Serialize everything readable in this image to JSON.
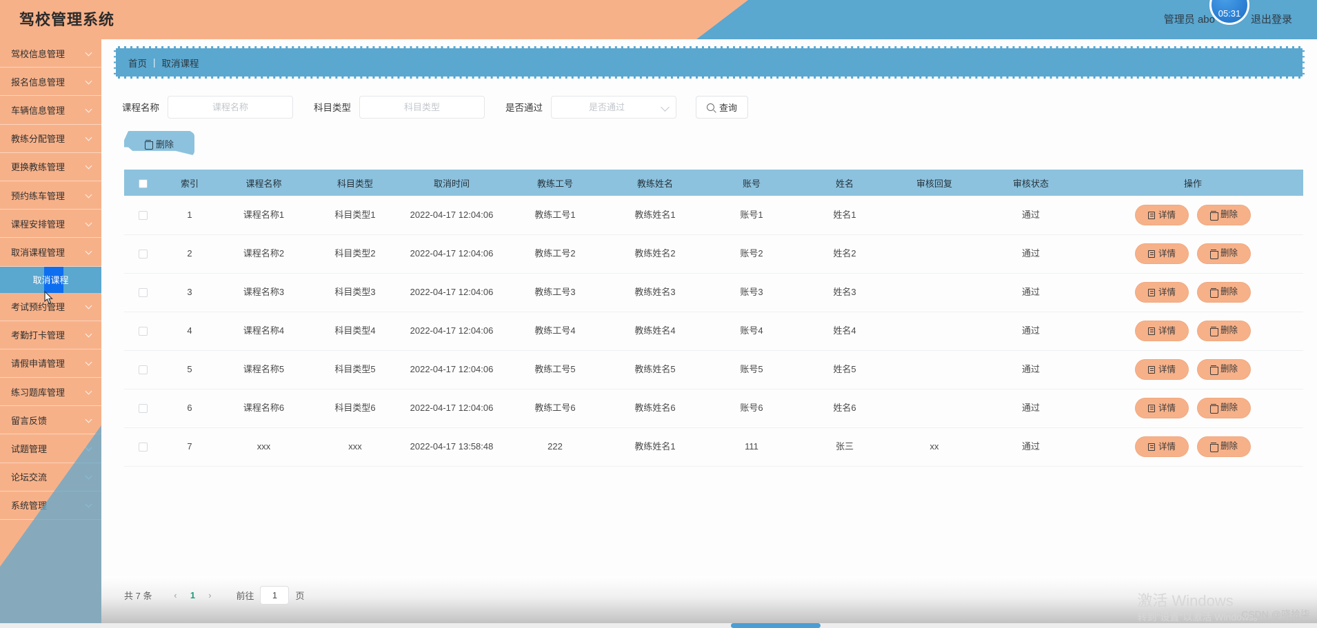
{
  "header": {
    "title": "驾校管理系统",
    "user": "管理员 abo",
    "logout": "退出登录",
    "rec_timer": "05:31",
    "accent_orange": "#f7b189",
    "accent_blue": "#5aa7d0"
  },
  "sidebar": {
    "items": [
      {
        "label": "驾校信息管理"
      },
      {
        "label": "报名信息管理"
      },
      {
        "label": "车辆信息管理"
      },
      {
        "label": "教练分配管理"
      },
      {
        "label": "更换教练管理"
      },
      {
        "label": "预约练车管理"
      },
      {
        "label": "课程安排管理"
      },
      {
        "label": "取消课程管理"
      }
    ],
    "active_submenu": "取消课程",
    "items_after": [
      {
        "label": "考试预约管理"
      },
      {
        "label": "考勤打卡管理"
      },
      {
        "label": "请假申请管理"
      },
      {
        "label": "练习题库管理"
      },
      {
        "label": "留言反馈"
      },
      {
        "label": "试题管理"
      },
      {
        "label": "论坛交流"
      },
      {
        "label": "系统管理"
      }
    ]
  },
  "breadcrumb": {
    "home": "首页",
    "separator": "|",
    "current": "取消课程"
  },
  "search": {
    "course_label": "课程名称",
    "course_placeholder": "课程名称",
    "course_value": "",
    "subject_label": "科目类型",
    "subject_placeholder": "科目类型",
    "subject_value": "",
    "pass_label": "是否通过",
    "pass_placeholder": "是否通过",
    "pass_value": "",
    "query_button": "查询"
  },
  "toolbar": {
    "delete_label": "删除"
  },
  "table": {
    "columns": [
      "索引",
      "课程名称",
      "科目类型",
      "取消时间",
      "教练工号",
      "教练姓名",
      "账号",
      "姓名",
      "审核回复",
      "审核状态",
      "操作"
    ],
    "rows": [
      {
        "index": "1",
        "course": "课程名称1",
        "subject": "科目类型1",
        "time": "2022-04-17 12:04:06",
        "coach_id": "教练工号1",
        "coach_name": "教练姓名1",
        "account": "账号1",
        "name": "姓名1",
        "reply": "",
        "status": "通过"
      },
      {
        "index": "2",
        "course": "课程名称2",
        "subject": "科目类型2",
        "time": "2022-04-17 12:04:06",
        "coach_id": "教练工号2",
        "coach_name": "教练姓名2",
        "account": "账号2",
        "name": "姓名2",
        "reply": "",
        "status": "通过"
      },
      {
        "index": "3",
        "course": "课程名称3",
        "subject": "科目类型3",
        "time": "2022-04-17 12:04:06",
        "coach_id": "教练工号3",
        "coach_name": "教练姓名3",
        "account": "账号3",
        "name": "姓名3",
        "reply": "",
        "status": "通过"
      },
      {
        "index": "4",
        "course": "课程名称4",
        "subject": "科目类型4",
        "time": "2022-04-17 12:04:06",
        "coach_id": "教练工号4",
        "coach_name": "教练姓名4",
        "account": "账号4",
        "name": "姓名4",
        "reply": "",
        "status": "通过"
      },
      {
        "index": "5",
        "course": "课程名称5",
        "subject": "科目类型5",
        "time": "2022-04-17 12:04:06",
        "coach_id": "教练工号5",
        "coach_name": "教练姓名5",
        "account": "账号5",
        "name": "姓名5",
        "reply": "",
        "status": "通过"
      },
      {
        "index": "6",
        "course": "课程名称6",
        "subject": "科目类型6",
        "time": "2022-04-17 12:04:06",
        "coach_id": "教练工号6",
        "coach_name": "教练姓名6",
        "account": "账号6",
        "name": "姓名6",
        "reply": "",
        "status": "通过"
      },
      {
        "index": "7",
        "course": "xxx",
        "subject": "xxx",
        "time": "2022-04-17 13:58:48",
        "coach_id": "222",
        "coach_name": "教练姓名1",
        "account": "111",
        "name": "张三",
        "reply": "xx",
        "status": "通过"
      }
    ],
    "row_actions": {
      "detail": "详情",
      "delete": "删除"
    }
  },
  "pagination": {
    "total": "共 7 条",
    "prev": "‹",
    "next": "›",
    "current_page": "1",
    "goto_label": "前往",
    "goto_value": "1",
    "goto_suffix": "页"
  },
  "watermark": {
    "line1": "激活 Windows",
    "line2": "转到\"设置\"以激活 Windows。",
    "csdn": "CSDN @哓拾柒"
  }
}
